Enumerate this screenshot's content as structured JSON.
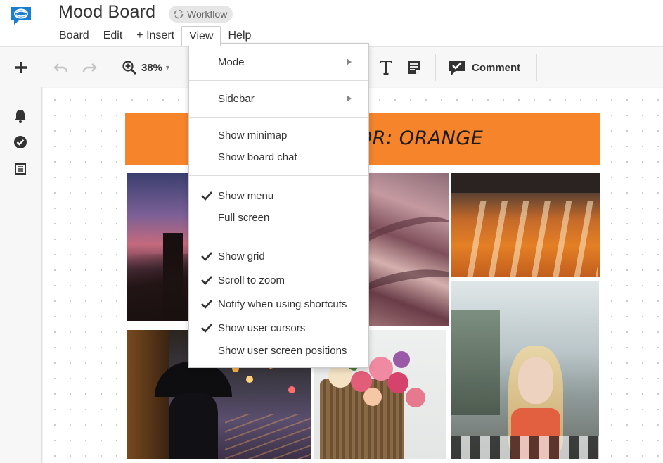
{
  "header": {
    "board_title": "Mood Board",
    "workflow_label": "Workflow",
    "brand_color": "#1b7fd1"
  },
  "menubar": {
    "items": [
      {
        "label": "Board"
      },
      {
        "label": "Edit"
      },
      {
        "label": "+ Insert"
      },
      {
        "label": "View",
        "active": true
      },
      {
        "label": "Help"
      }
    ]
  },
  "toolbar": {
    "zoom_value": "38%",
    "comment_label": "Comment",
    "icons": [
      "plus-icon",
      "undo-icon",
      "redo-icon",
      "zoom-icon",
      "text-icon",
      "note-icon",
      "comment-icon"
    ]
  },
  "sidebar": {
    "icons": [
      "bell-icon",
      "check-circle-icon",
      "list-icon"
    ]
  },
  "canvas": {
    "banner_text": "OR: ORANGE",
    "banner_color": "#f6842a"
  },
  "view_menu": {
    "mode_label": "Mode",
    "sidebar_label": "Sidebar",
    "show_minimap": "Show minimap",
    "show_board_chat": "Show board chat",
    "show_menu": "Show menu",
    "full_screen": "Full screen",
    "show_grid": "Show grid",
    "scroll_to_zoom": "Scroll to zoom",
    "notify_shortcuts": "Notify when using shortcuts",
    "show_user_cursors": "Show user cursors",
    "show_user_screen_positions": "Show user screen positions"
  }
}
